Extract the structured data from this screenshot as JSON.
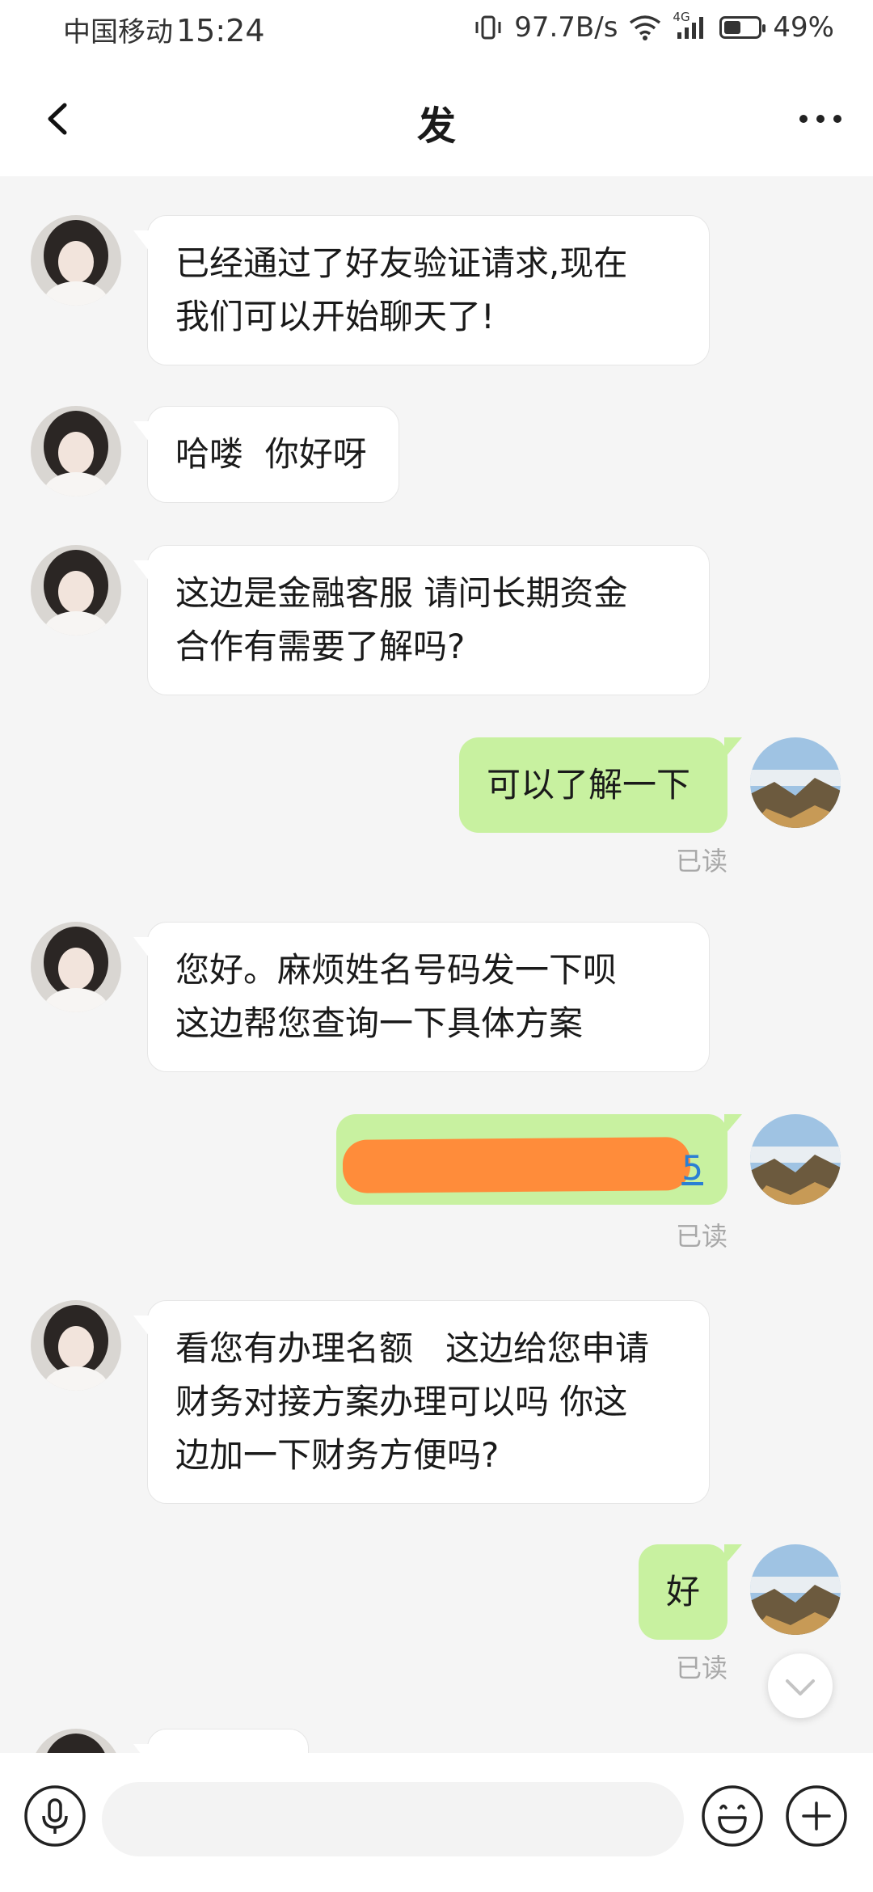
{
  "status_bar": {
    "carrier": "中国移动",
    "time": "15:24",
    "speed": "97.7B/s",
    "network": "4G",
    "battery": "49%",
    "battery_level": 0.49
  },
  "header": {
    "title": "发",
    "back_icon": "chevron-left-icon",
    "more_icon": "more-dots-icon"
  },
  "messages": [
    {
      "side": "in",
      "text": "已经通过了好友验证请求,现在\n我们可以开始聊天了!"
    },
    {
      "side": "in",
      "text": "哈喽  你好呀"
    },
    {
      "side": "in",
      "text": "这边是金融客服 请问长期资金\n合作有需要了解吗?"
    },
    {
      "side": "out",
      "text": "可以了解一下",
      "status": "已读"
    },
    {
      "side": "in",
      "text": "您好。麻烦姓名号码发一下呗\n这边帮您查询一下具体方案"
    },
    {
      "side": "out",
      "text": "5",
      "redacted": true,
      "status": "已读"
    },
    {
      "side": "in",
      "text": "看您有办理名额   这边给您申请\n财务对接方案办理可以吗 你这\n边加一下财务方便吗?"
    },
    {
      "side": "out",
      "text": "好",
      "status": "已读"
    }
  ],
  "input_bar": {
    "voice_icon": "microphone-icon",
    "placeholder": "",
    "emoji_icon": "emoji-icon",
    "add_icon": "plus-icon"
  },
  "colors": {
    "outgoing_bubble": "#c8f1a0",
    "incoming_bubble": "#ffffff",
    "background": "#f5f5f5",
    "redaction": "#ff8c3a"
  }
}
